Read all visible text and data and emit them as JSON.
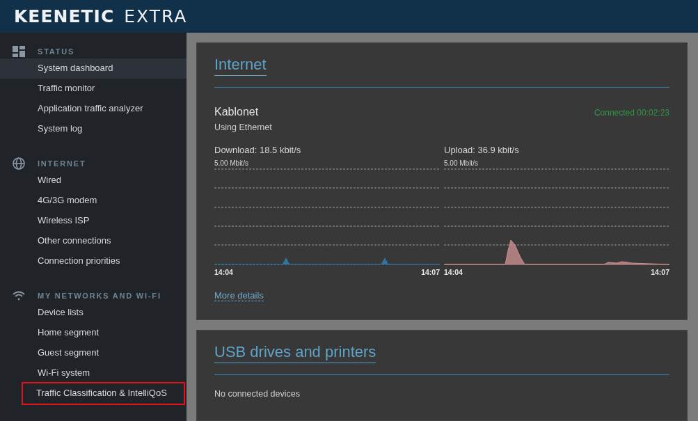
{
  "header": {
    "brand": "KEENETIC",
    "model": "EXTRA"
  },
  "sidebar": {
    "sections": [
      {
        "kind": "status",
        "title": "STATUS",
        "items": [
          {
            "label": "System dashboard",
            "selected": true,
            "highlighted": false
          },
          {
            "label": "Traffic monitor",
            "selected": false,
            "highlighted": false
          },
          {
            "label": "Application traffic analyzer",
            "selected": false,
            "highlighted": false
          },
          {
            "label": "System log",
            "selected": false,
            "highlighted": false
          }
        ]
      },
      {
        "kind": "internet",
        "title": "INTERNET",
        "items": [
          {
            "label": "Wired",
            "selected": false,
            "highlighted": false
          },
          {
            "label": "4G/3G modem",
            "selected": false,
            "highlighted": false
          },
          {
            "label": "Wireless ISP",
            "selected": false,
            "highlighted": false
          },
          {
            "label": "Other connections",
            "selected": false,
            "highlighted": false
          },
          {
            "label": "Connection priorities",
            "selected": false,
            "highlighted": false
          }
        ]
      },
      {
        "kind": "wifi",
        "title": "MY NETWORKS AND WI-FI",
        "items": [
          {
            "label": "Device lists",
            "selected": false,
            "highlighted": false
          },
          {
            "label": "Home segment",
            "selected": false,
            "highlighted": false
          },
          {
            "label": "Guest segment",
            "selected": false,
            "highlighted": false
          },
          {
            "label": "Wi-Fi system",
            "selected": false,
            "highlighted": false
          },
          {
            "label": "Traffic Classification & IntelliQoS",
            "selected": false,
            "highlighted": true
          }
        ]
      }
    ]
  },
  "internet_card": {
    "title": "Internet",
    "connection": "Kablonet",
    "via": "Using Ethernet",
    "status": "Connected 00:02:23",
    "graphs": [
      {
        "kind": "download",
        "label": "Download: 18.5 kbit/s",
        "scale": "5.00 Mbit/s",
        "start": "14:04",
        "end": "14:07"
      },
      {
        "kind": "upload",
        "label": "Upload: 36.9 kbit/s",
        "scale": "5.00 Mbit/s",
        "start": "14:04",
        "end": "14:07"
      }
    ],
    "link": "More details"
  },
  "usb_card": {
    "title": "USB drives and printers",
    "message": "No connected devices"
  }
}
